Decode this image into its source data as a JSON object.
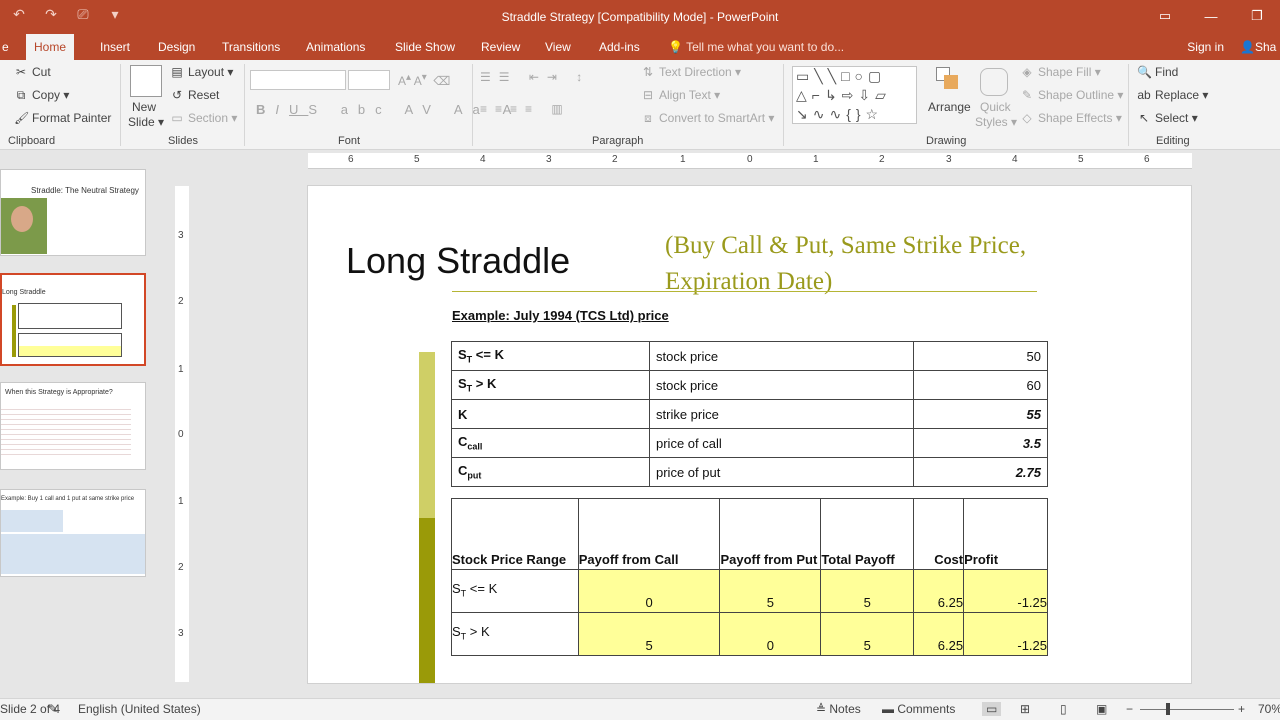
{
  "window": {
    "title": "Straddle Strategy [Compatibility Mode] - PowerPoint",
    "qat_icons": [
      "undo-icon",
      "redo-icon",
      "start-presentation-icon",
      "customize-qat-icon"
    ]
  },
  "tabs": [
    {
      "label": "Home",
      "active": true
    },
    {
      "label": "Insert"
    },
    {
      "label": "Design"
    },
    {
      "label": "Transitions"
    },
    {
      "label": "Animations"
    },
    {
      "label": "Slide Show"
    },
    {
      "label": "Review"
    },
    {
      "label": "View"
    },
    {
      "label": "Add-ins"
    }
  ],
  "tell_me": "Tell me what you want to do...",
  "sign_in": "Sign in",
  "share": "Sha",
  "ribbon": {
    "clipboard": {
      "cut": "Cut",
      "copy": "Copy",
      "format_painter": "Format Painter",
      "label": "Clipboard"
    },
    "slides": {
      "new_slide_1": "New",
      "new_slide_2": "Slide",
      "layout": "Layout",
      "reset": "Reset",
      "section": "Section",
      "label": "Slides"
    },
    "font": {
      "label": "Font"
    },
    "paragraph": {
      "text_direction": "Text Direction",
      "align_text": "Align Text",
      "convert_smartart": "Convert to SmartArt",
      "label": "Paragraph"
    },
    "drawing": {
      "arrange": "Arrange",
      "quick_styles_1": "Quick",
      "quick_styles_2": "Styles",
      "shape_fill": "Shape Fill",
      "shape_outline": "Shape Outline",
      "shape_effects": "Shape Effects",
      "label": "Drawing"
    },
    "editing": {
      "find": "Find",
      "replace": "Replace",
      "select": "Select",
      "label": "Editing"
    }
  },
  "thumbnails": [
    {
      "title": "Straddle: The Neutral Strategy"
    },
    {
      "title": "Long Straddle"
    },
    {
      "title": "When this Strategy is Appropriate?"
    },
    {
      "title": "Example: Buy 1 call and 1 put at same strike price"
    }
  ],
  "slide": {
    "title": "Long Straddle",
    "subtitle": "(Buy Call & Put, Same Strike Price, Expiration  Date)",
    "example": "Example: July 1994 (TCS Ltd) price",
    "inputs": [
      {
        "sym": "S",
        "sub": "T",
        "rest": " <= K",
        "desc": "stock price",
        "value": "50"
      },
      {
        "sym": "S",
        "sub": "T",
        "rest": " > K",
        "desc": "stock price",
        "value": "60"
      },
      {
        "sym": "K",
        "sub": "",
        "rest": "",
        "desc": "strike price",
        "value": "55"
      },
      {
        "sym": "C",
        "sub": "call",
        "rest": "",
        "desc": "price of call",
        "value": "3.5"
      },
      {
        "sym": "C",
        "sub": "put",
        "rest": "",
        "desc": "price of put",
        "value": "2.75"
      }
    ],
    "payoff_headers": [
      "Stock Price Range",
      "Payoff from Call",
      "Payoff from Put",
      "Total Payoff",
      "Cost",
      "Profit"
    ],
    "payoff_rows": [
      {
        "sym": "S",
        "sub": "T",
        "rest": " <= K",
        "call": "0",
        "put": "5",
        "total": "5",
        "cost": "6.25",
        "profit": "-1.25"
      },
      {
        "sym": "S",
        "sub": "T",
        "rest": " > K",
        "call": "5",
        "put": "0",
        "total": "5",
        "cost": "6.25",
        "profit": "-1.25"
      }
    ]
  },
  "status": {
    "slide_of": "2 of 4",
    "language": "English (United States)",
    "notes": "Notes",
    "comments": "Comments",
    "zoom": "70%"
  },
  "rulers": {
    "h_labels": [
      "6",
      "5",
      "4",
      "3",
      "2",
      "1",
      "0",
      "1",
      "2",
      "3",
      "4",
      "5",
      "6"
    ],
    "v_labels": [
      "3",
      "2",
      "1",
      "0",
      "1",
      "2",
      "3"
    ]
  },
  "colors": {
    "accent": "#b7472a",
    "subtitle": "#9a9a1c",
    "highlight": "#ffff99"
  }
}
